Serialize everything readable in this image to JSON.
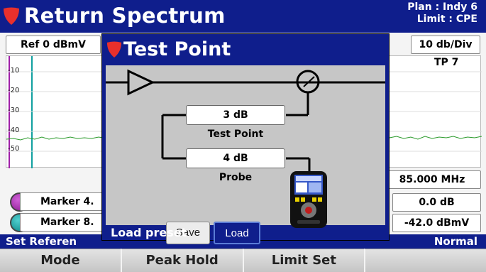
{
  "app": {
    "title": "Return Spectrum",
    "plan": "Plan : Indy 6",
    "limit": "Limit : CPE"
  },
  "controls": {
    "ref": "Ref 0 dBmV",
    "scale": "10 db/Div",
    "test_point_label": "TP 7"
  },
  "graph": {
    "y_ticks": [
      "-10",
      "-20",
      "-30",
      "-40",
      "-50"
    ]
  },
  "markers": [
    {
      "label": "Marker 4.",
      "color": "#a020a8"
    },
    {
      "label": "Marker 8.",
      "color": "#10a0a0"
    }
  ],
  "readouts": {
    "frequency": "85.000 MHz",
    "delta": "0.0 dB",
    "level": "-42.0 dBmV"
  },
  "statusbar": {
    "left": "Set Referen",
    "right": "Normal"
  },
  "softkeys": [
    "Mode",
    "Peak Hold",
    "Limit Set",
    ""
  ],
  "dialog": {
    "title": "Test Point",
    "test_point_value": "3 dB",
    "test_point_caption": "Test Point",
    "probe_value": "4 dB",
    "probe_caption": "Probe",
    "save_label": "Save",
    "load_label": "Load",
    "hint": "Load preset"
  },
  "colors": {
    "primary": "#0f1e8c",
    "accent_red": "#e8302c",
    "trace": "#2a9a2a"
  }
}
